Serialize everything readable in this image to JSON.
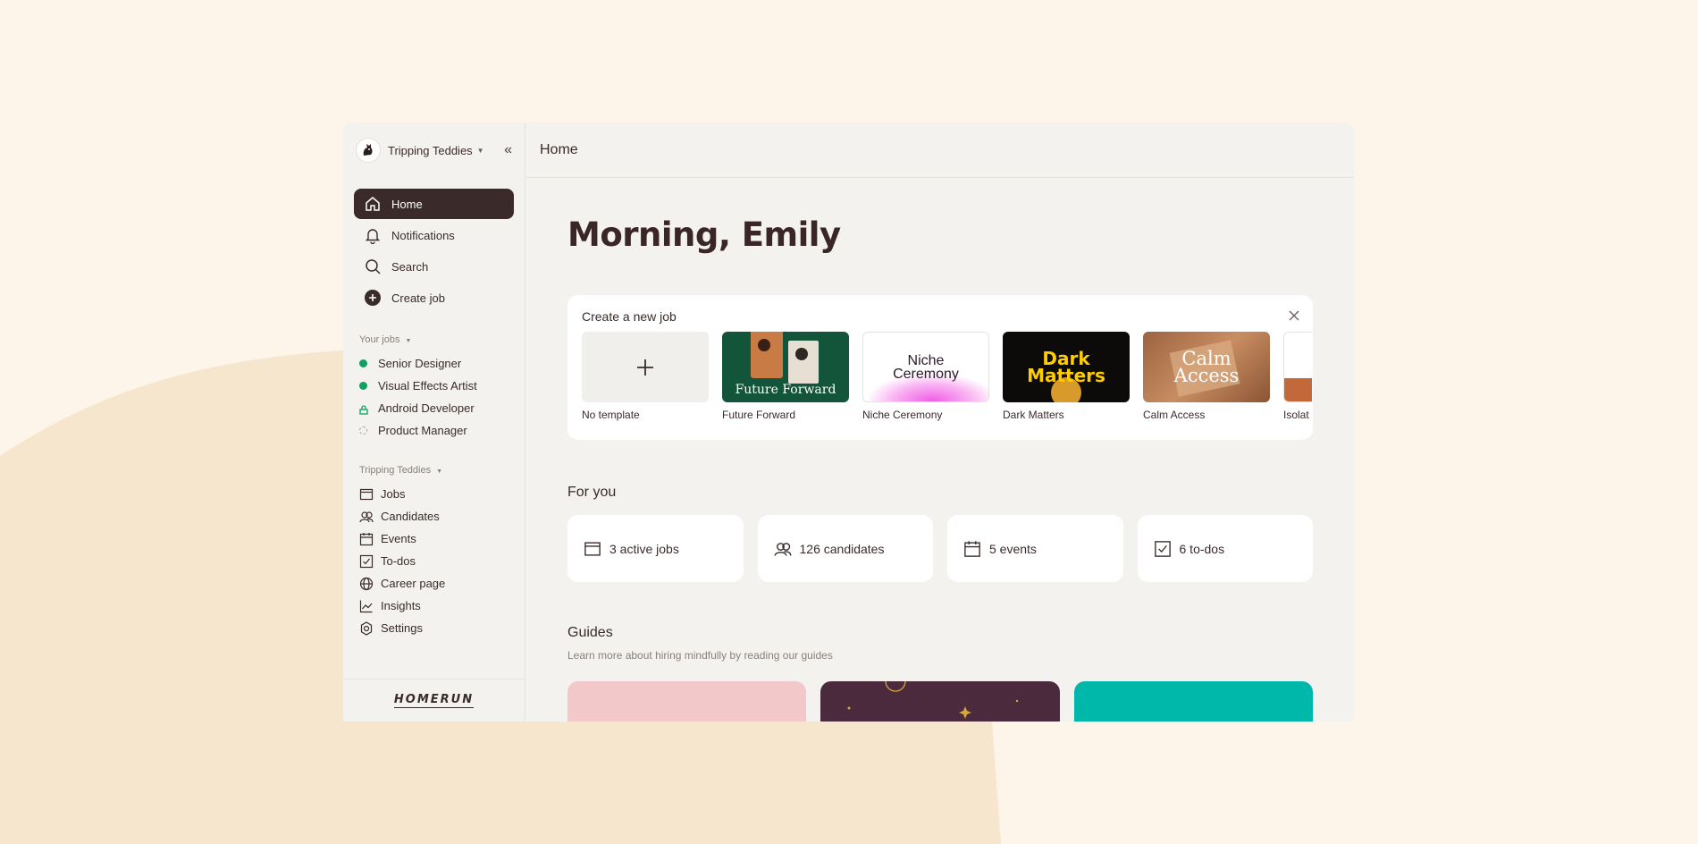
{
  "colors": {
    "accent": "#3b2a2a",
    "green": "#10a060",
    "teal": "#00b8a9",
    "pink": "#f2c8c9",
    "plum": "#4a2a3c"
  },
  "sidebar": {
    "org_name": "Tripping Teddies",
    "collapse_icon": "double-chevron-left-icon",
    "nav": [
      {
        "label": "Home",
        "icon": "home-icon"
      },
      {
        "label": "Notifications",
        "icon": "bell-icon"
      },
      {
        "label": "Search",
        "icon": "search-icon"
      },
      {
        "label": "Create job",
        "icon": "plus-circle-icon"
      }
    ],
    "your_jobs_label": "Your jobs",
    "jobs": [
      {
        "label": "Senior Designer",
        "status": "published"
      },
      {
        "label": "Visual Effects Artist",
        "status": "published"
      },
      {
        "label": "Android Developer",
        "status": "private"
      },
      {
        "label": "Product Manager",
        "status": "draft"
      }
    ],
    "org_section_label": "Tripping Teddies",
    "org_items": [
      {
        "label": "Jobs",
        "icon": "browser-icon"
      },
      {
        "label": "Candidates",
        "icon": "people-icon"
      },
      {
        "label": "Events",
        "icon": "calendar-icon"
      },
      {
        "label": "To-dos",
        "icon": "checkbox-icon"
      },
      {
        "label": "Career page",
        "icon": "globe-icon"
      },
      {
        "label": "Insights",
        "icon": "chart-icon"
      },
      {
        "label": "Settings",
        "icon": "gear-icon"
      }
    ],
    "logo": "HOMERUN"
  },
  "header": {
    "title": "Home"
  },
  "main": {
    "greeting": "Morning, Emily",
    "create_card": {
      "title": "Create a new job",
      "templates": [
        {
          "label": "No template"
        },
        {
          "label": "Future Forward",
          "thumb_text": "Future Forward"
        },
        {
          "label": "Niche Ceremony",
          "thumb_text": "Niche Ceremony"
        },
        {
          "label": "Dark Matters",
          "thumb_text": "Dark Matters"
        },
        {
          "label": "Calm Access",
          "thumb_text": "Calm Access"
        },
        {
          "label": "Isolat"
        }
      ]
    },
    "for_you": {
      "title": "For you",
      "stats": [
        {
          "label": "3 active jobs",
          "icon": "browser-icon"
        },
        {
          "label": "126 candidates",
          "icon": "people-icon"
        },
        {
          "label": "5 events",
          "icon": "calendar-icon"
        },
        {
          "label": "6 to-dos",
          "icon": "checkbox-icon"
        }
      ]
    },
    "guides": {
      "title": "Guides",
      "subtitle": "Learn more about hiring mindfully by reading our guides"
    }
  }
}
